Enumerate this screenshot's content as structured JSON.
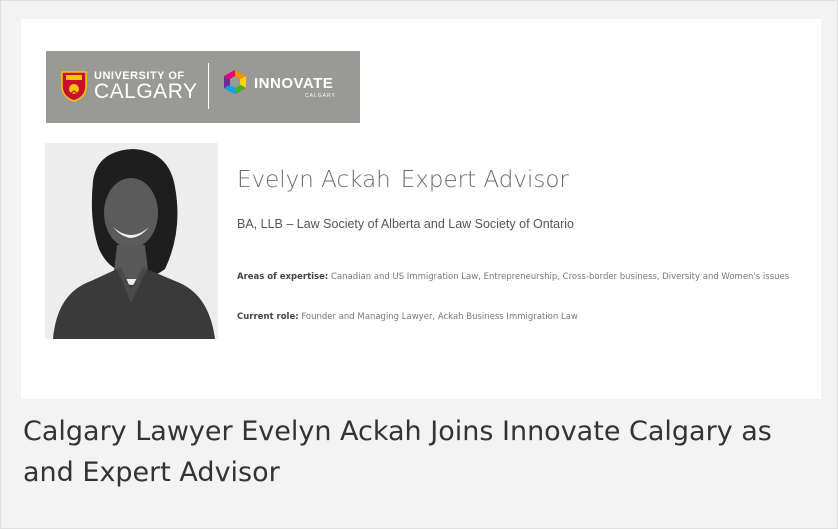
{
  "logos": {
    "university_top": "UNIVERSITY OF",
    "university_bottom": "CALGARY",
    "innovate_word": "INNOVATE",
    "innovate_sub": "CALGARY"
  },
  "profile": {
    "name": "Evelyn Ackah",
    "role": "Expert Advisor",
    "credentials": "BA, LLB – Law Society of Alberta and Law Society of Ontario",
    "expertise_label": "Areas of expertise:",
    "expertise_value": "Canadian and US Immigration Law, Entrepreneurship, Cross-border business, Diversity and Women's issues",
    "current_role_label": "Current role:",
    "current_role_value": "Founder and Managing Lawyer, Ackah Business Immigration Law"
  },
  "headline": "Calgary Lawyer Evelyn Ackah Joins Innovate Calgary as and Expert Advisor",
  "colors": {
    "page_background": "#f3f3f3",
    "banner_gray": "#9a9a94",
    "uofc_red": "#c8102e",
    "uofc_gold": "#f5c400"
  },
  "icons": {
    "crest": "university-crest-icon",
    "innovate_mark": "innovate-hexagon-icon"
  }
}
